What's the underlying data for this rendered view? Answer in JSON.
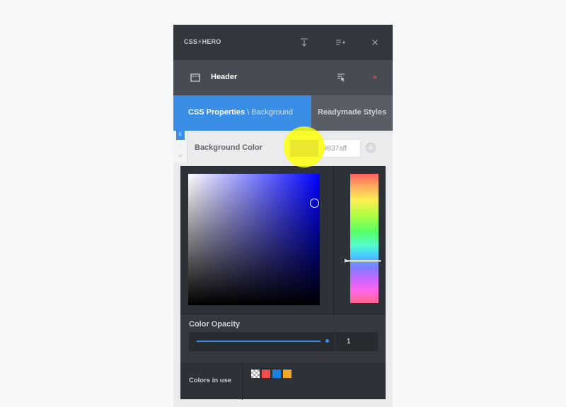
{
  "topbar": {
    "logo_left": "CSS",
    "logo_bolt": "⚡",
    "logo_right": "HERO"
  },
  "header": {
    "title": "Header",
    "badge": "R"
  },
  "tabs": {
    "active_main": "CSS Properties",
    "active_separator": "\\",
    "active_sub": "Background",
    "inactive": "Readymade Styles"
  },
  "side_tabs": [
    "E",
    "⋮",
    "▭"
  ],
  "property": {
    "label": "Background Color",
    "hex_value": "#837aff",
    "swatch_color": "#837aff"
  },
  "picker": {
    "hue_color": "#0000ff"
  },
  "opacity": {
    "label": "Color Opacity",
    "value": "1",
    "fraction": 1
  },
  "colors_in_use": {
    "label": "Colors in use",
    "chips": [
      "transparent",
      "#f04e4e",
      "#1a7fe0",
      "#f5a623"
    ]
  },
  "colors": {
    "accent": "#3a8ee6",
    "topbar": "#32373e",
    "header": "#474c54",
    "picker_bg": "#2d3239"
  }
}
